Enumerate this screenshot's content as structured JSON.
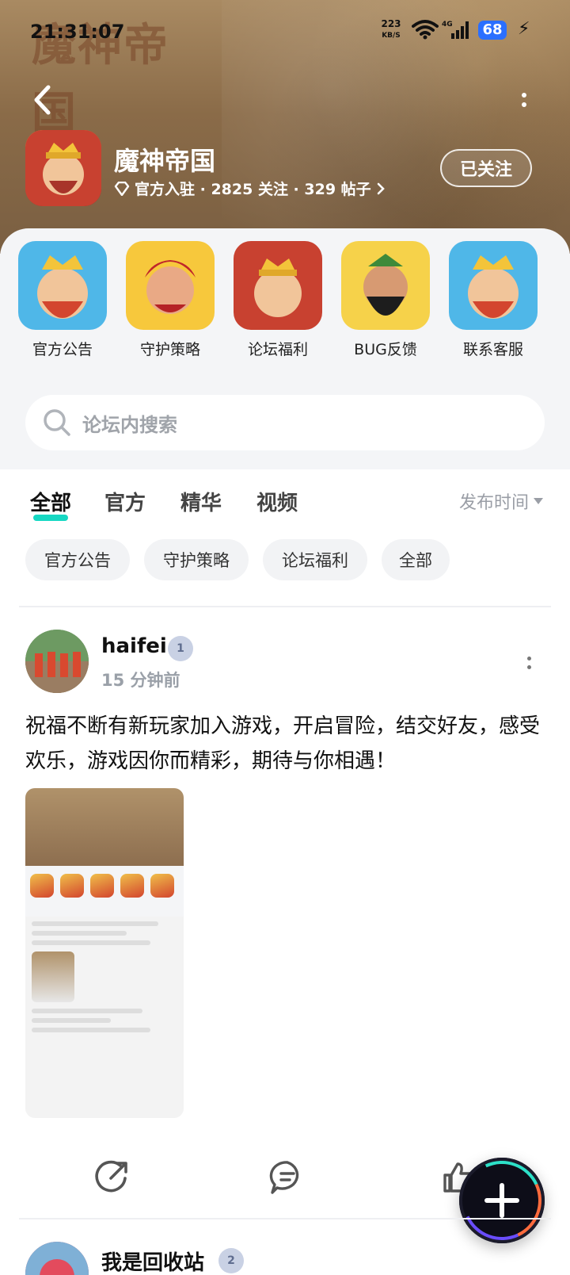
{
  "status_bar": {
    "time": "21:31:07",
    "net_speed_value": "223",
    "net_speed_unit": "KB/S",
    "network": "4G",
    "battery": "68"
  },
  "header": {
    "logo_text": "魔神帝国",
    "forum_name": "魔神帝国",
    "meta": "官方入驻 · 2825 关注 · 329 帖子",
    "follow_label": "已关注"
  },
  "channels": [
    {
      "label": "官方公告",
      "icon": "official-notice-icon"
    },
    {
      "label": "守护策略",
      "icon": "guard-strategy-icon"
    },
    {
      "label": "论坛福利",
      "icon": "forum-benefits-icon"
    },
    {
      "label": "BUG反馈",
      "icon": "bug-feedback-icon"
    },
    {
      "label": "联系客服",
      "icon": "customer-service-icon"
    }
  ],
  "search": {
    "placeholder": "论坛内搜索"
  },
  "tabs": [
    {
      "label": "全部",
      "active": true
    },
    {
      "label": "官方",
      "active": false
    },
    {
      "label": "精华",
      "active": false
    },
    {
      "label": "视频",
      "active": false
    }
  ],
  "sort": {
    "label": "发布时间"
  },
  "chips": [
    "官方公告",
    "守护策略",
    "论坛福利",
    "全部"
  ],
  "posts": [
    {
      "username": "haifei",
      "level": "1",
      "time": "15 分钟前",
      "text": "祝福不断有新玩家加入游戏，开启冒险，结交好友，感受欢乐，游戏因你而精彩，期待与你相遇！"
    },
    {
      "username": "我是回收站",
      "level": "2"
    }
  ],
  "colors": {
    "accent": "#16d8c3",
    "battery": "#2b6fff",
    "header_brown": "#8a6b48"
  }
}
